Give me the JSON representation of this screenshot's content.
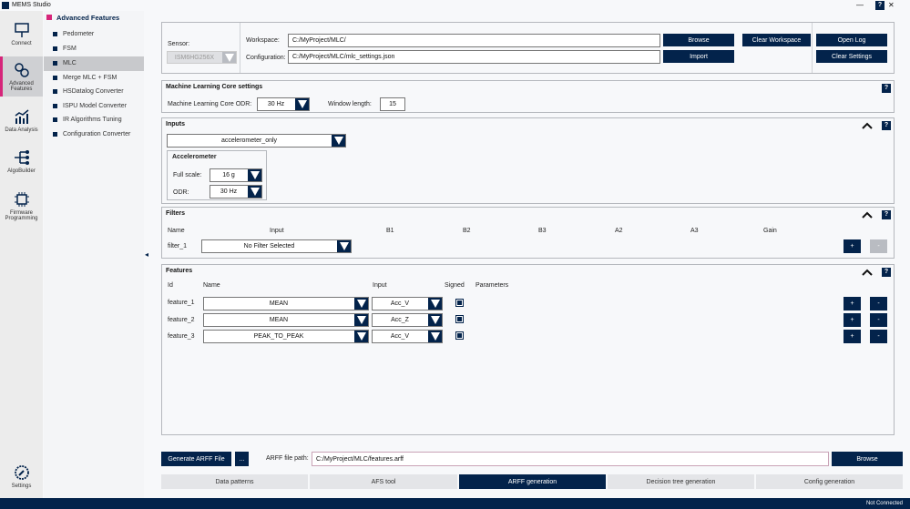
{
  "app": {
    "title": "MEMS Studio",
    "minimize": "—",
    "close": "✕"
  },
  "rail": [
    {
      "label": "Connect",
      "icon": "connect-icon"
    },
    {
      "label": "Advanced Features",
      "icon": "gears-icon"
    },
    {
      "label": "Data Analysis",
      "icon": "chart-icon"
    },
    {
      "label": "AlgoBuilder",
      "icon": "flow-icon"
    },
    {
      "label": "Firmware Programming",
      "icon": "chip-icon"
    },
    {
      "label": "Settings",
      "icon": "settings-icon"
    }
  ],
  "submenu": {
    "title": "Advanced Features",
    "items": [
      "Pedometer",
      "FSM",
      "MLC",
      "Merge MLC + FSM",
      "HSDatalog Converter",
      "ISPU Model Converter",
      "IR Algorithms Tuning",
      "Configuration Converter"
    ],
    "selected": "MLC"
  },
  "collapse_arrow": "◂",
  "top": {
    "sensor_label": "Sensor:",
    "sensor_value": "ISM6HG256X",
    "workspace_label": "Workspace:",
    "workspace_value": "C:/MyProject/MLC/",
    "config_label": "Configuration:",
    "config_value": "C:/MyProject/MLC/mlc_settings.json",
    "browse": "Browse",
    "clear_workspace": "Clear Workspace",
    "import": "Import",
    "open_log": "Open Log",
    "clear_settings": "Clear Settings",
    "help": "?"
  },
  "mlc": {
    "title": "Machine Learning Core settings",
    "odr_label": "Machine Learning Core ODR:",
    "odr_value": "30 Hz",
    "window_label": "Window length:",
    "window_value": "15",
    "help": "?"
  },
  "inputs": {
    "title": "Inputs",
    "input_value": "accelerometer_only",
    "accel_title": "Accelerometer",
    "fs_label": "Full scale:",
    "fs_value": "16 g",
    "odr_label": "ODR:",
    "odr_value": "30 Hz",
    "help": "?"
  },
  "filters": {
    "title": "Filters",
    "headers": [
      "Name",
      "Input",
      "B1",
      "B2",
      "B3",
      "A2",
      "A3",
      "Gain"
    ],
    "rows": [
      {
        "name": "filter_1",
        "input": "No Filter Selected"
      }
    ],
    "add": "+",
    "remove": "-",
    "help": "?"
  },
  "features": {
    "title": "Features",
    "headers": [
      "Id",
      "Name",
      "Input",
      "Signed",
      "Parameters"
    ],
    "rows": [
      {
        "id": "feature_1",
        "name": "MEAN",
        "input": "Acc_V",
        "signed": true
      },
      {
        "id": "feature_2",
        "name": "MEAN",
        "input": "Acc_Z",
        "signed": true
      },
      {
        "id": "feature_3",
        "name": "PEAK_TO_PEAK",
        "input": "Acc_V",
        "signed": true
      }
    ],
    "add": "+",
    "remove": "-",
    "help": "?"
  },
  "arff": {
    "generate": "Generate ARFF File",
    "more": "...",
    "path_label": "ARFF file path:",
    "path_value": "C:/MyProject/MLC/features.arff",
    "browse": "Browse"
  },
  "tabs": [
    "Data patterns",
    "AFS tool",
    "ARFF generation",
    "Decision tree generation",
    "Config generation"
  ],
  "selected_tab": "ARFF generation",
  "status": "Not Connected",
  "colors": {
    "accent": "#03234b",
    "highlight": "#d6257a"
  }
}
